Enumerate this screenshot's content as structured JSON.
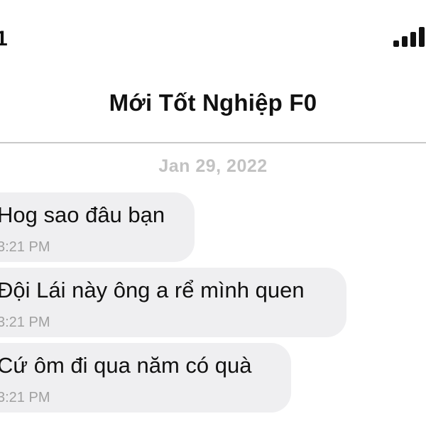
{
  "status_bar": {
    "left_text": "1",
    "signal_icon": "signal-bars-icon"
  },
  "conversation": {
    "title": "Mới Tốt Nghiệp F0"
  },
  "date_separator": "Jan 29, 2022",
  "messages": [
    {
      "text": "Hog sao đâu bạn",
      "time": "3:21 PM"
    },
    {
      "text": "Đội Lái này ông a rể mình quen",
      "time": "3:21 PM"
    },
    {
      "text": "Cứ ôm đi qua năm có quà",
      "time": "3:21 PM"
    }
  ],
  "colors": {
    "bubble_background": "#efeff1",
    "time_text": "#a0a0a0",
    "date_text": "#c2c2c2",
    "divider": "#c9c9c9"
  }
}
